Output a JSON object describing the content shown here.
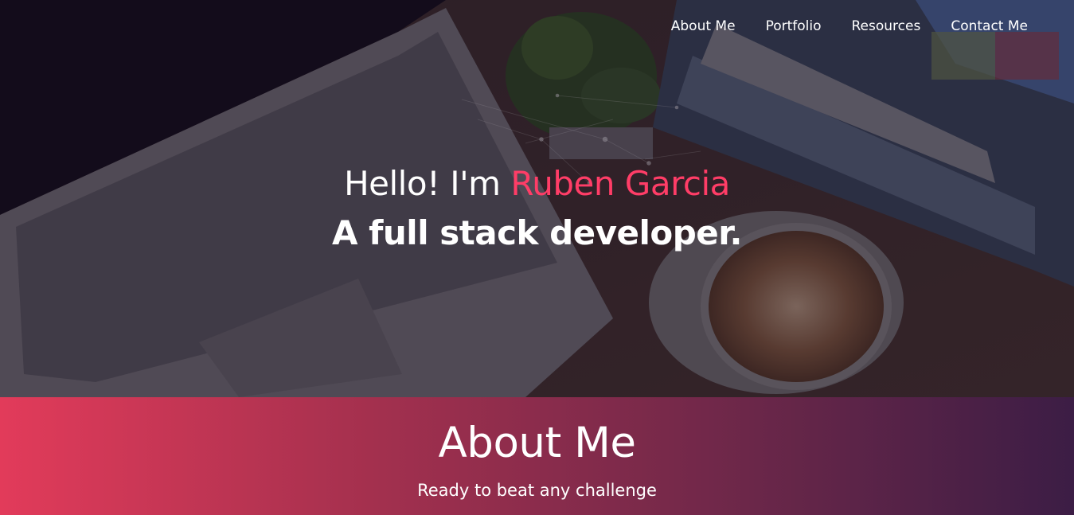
{
  "nav": {
    "items": [
      {
        "label": "About Me"
      },
      {
        "label": "Portfolio"
      },
      {
        "label": "Resources"
      },
      {
        "label": "Contact Me"
      }
    ]
  },
  "hero": {
    "greeting_prefix": "Hello! I'm ",
    "name": "Ruben Garcia",
    "subtitle": "A full stack developer."
  },
  "about": {
    "title": "About Me",
    "tagline": "Ready to beat any challenge"
  },
  "colors": {
    "accent": "#ff3d67",
    "gradient_start": "#e23b5a",
    "gradient_end": "#3c1d45"
  },
  "icons": [
    "laptop-image",
    "plant-image",
    "coffee-cup-image",
    "books-image"
  ]
}
